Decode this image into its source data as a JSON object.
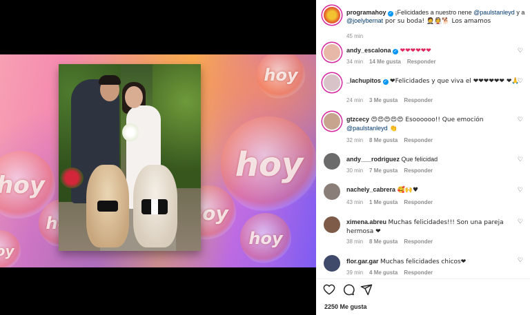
{
  "post": {
    "author": "programahoy",
    "caption_prefix": "¡Felicidades a nuestro nene ",
    "mention1": "@paulstanleyd",
    "caption_mid": " y a ",
    "mention2": "@joelybernat",
    "caption_suffix": " por su boda! 🤵👰🐕 Los amamos",
    "time": "45 min"
  },
  "image": {
    "watermark": "hoy"
  },
  "comments": [
    {
      "user": "andy_escalona",
      "verified": true,
      "text": "❤❤❤❤❤❤",
      "time": "34 min",
      "likes": "14 Me gusta",
      "reply": "Responder",
      "avatar_color": "#e7b8a8"
    },
    {
      "user": "_lachupitos",
      "verified": true,
      "text": "❤Felicidades y que viva el ❤❤❤❤❤❤ ❤🙏",
      "time": "24 min",
      "likes": "3 Me gusta",
      "reply": "Responder",
      "avatar_color": "#d7c3c8"
    },
    {
      "user": "gtzcecy",
      "verified": false,
      "text_prefix": "😍😍😍😍😍 Esoooooo!! Que emoción ",
      "mention": "@paulstanleyd",
      "text_suffix": " 👏",
      "time": "32 min",
      "likes": "8 Me gusta",
      "reply": "Responder",
      "avatar_color": "#c7a48e"
    },
    {
      "user": "andy___rodriguez",
      "verified": false,
      "text": "Que felicidad",
      "time": "30 min",
      "likes": "7 Me gusta",
      "reply": "Responder",
      "avatar_color": "#6b6b6b"
    },
    {
      "user": "nachely_cabrera",
      "verified": false,
      "text": "🥰🙌♥",
      "time": "43 min",
      "likes": "1 Me gusta",
      "reply": "Responder",
      "avatar_color": "#8a7f78"
    },
    {
      "user": "ximena.abreu",
      "verified": false,
      "text": "Muchas felicidades!!! Son una pareja hermosa ❤",
      "time": "38 min",
      "likes": "8 Me gusta",
      "reply": "Responder",
      "avatar_color": "#7d5b48"
    },
    {
      "user": "flor.gar.gar",
      "verified": false,
      "text": "Muchas felicidades chicos❤",
      "time": "39 min",
      "likes": "4 Me gusta",
      "reply": "Responder",
      "avatar_color": "#3f4a6a"
    }
  ],
  "actions": {
    "like_icon": "heart-icon",
    "comment_icon": "comment-icon",
    "share_icon": "share-icon"
  },
  "likes_count": "2250 Me gusta",
  "colors": {
    "mention": "#00376b",
    "verified": "#0095f6",
    "story_ring": "#d6249f"
  }
}
